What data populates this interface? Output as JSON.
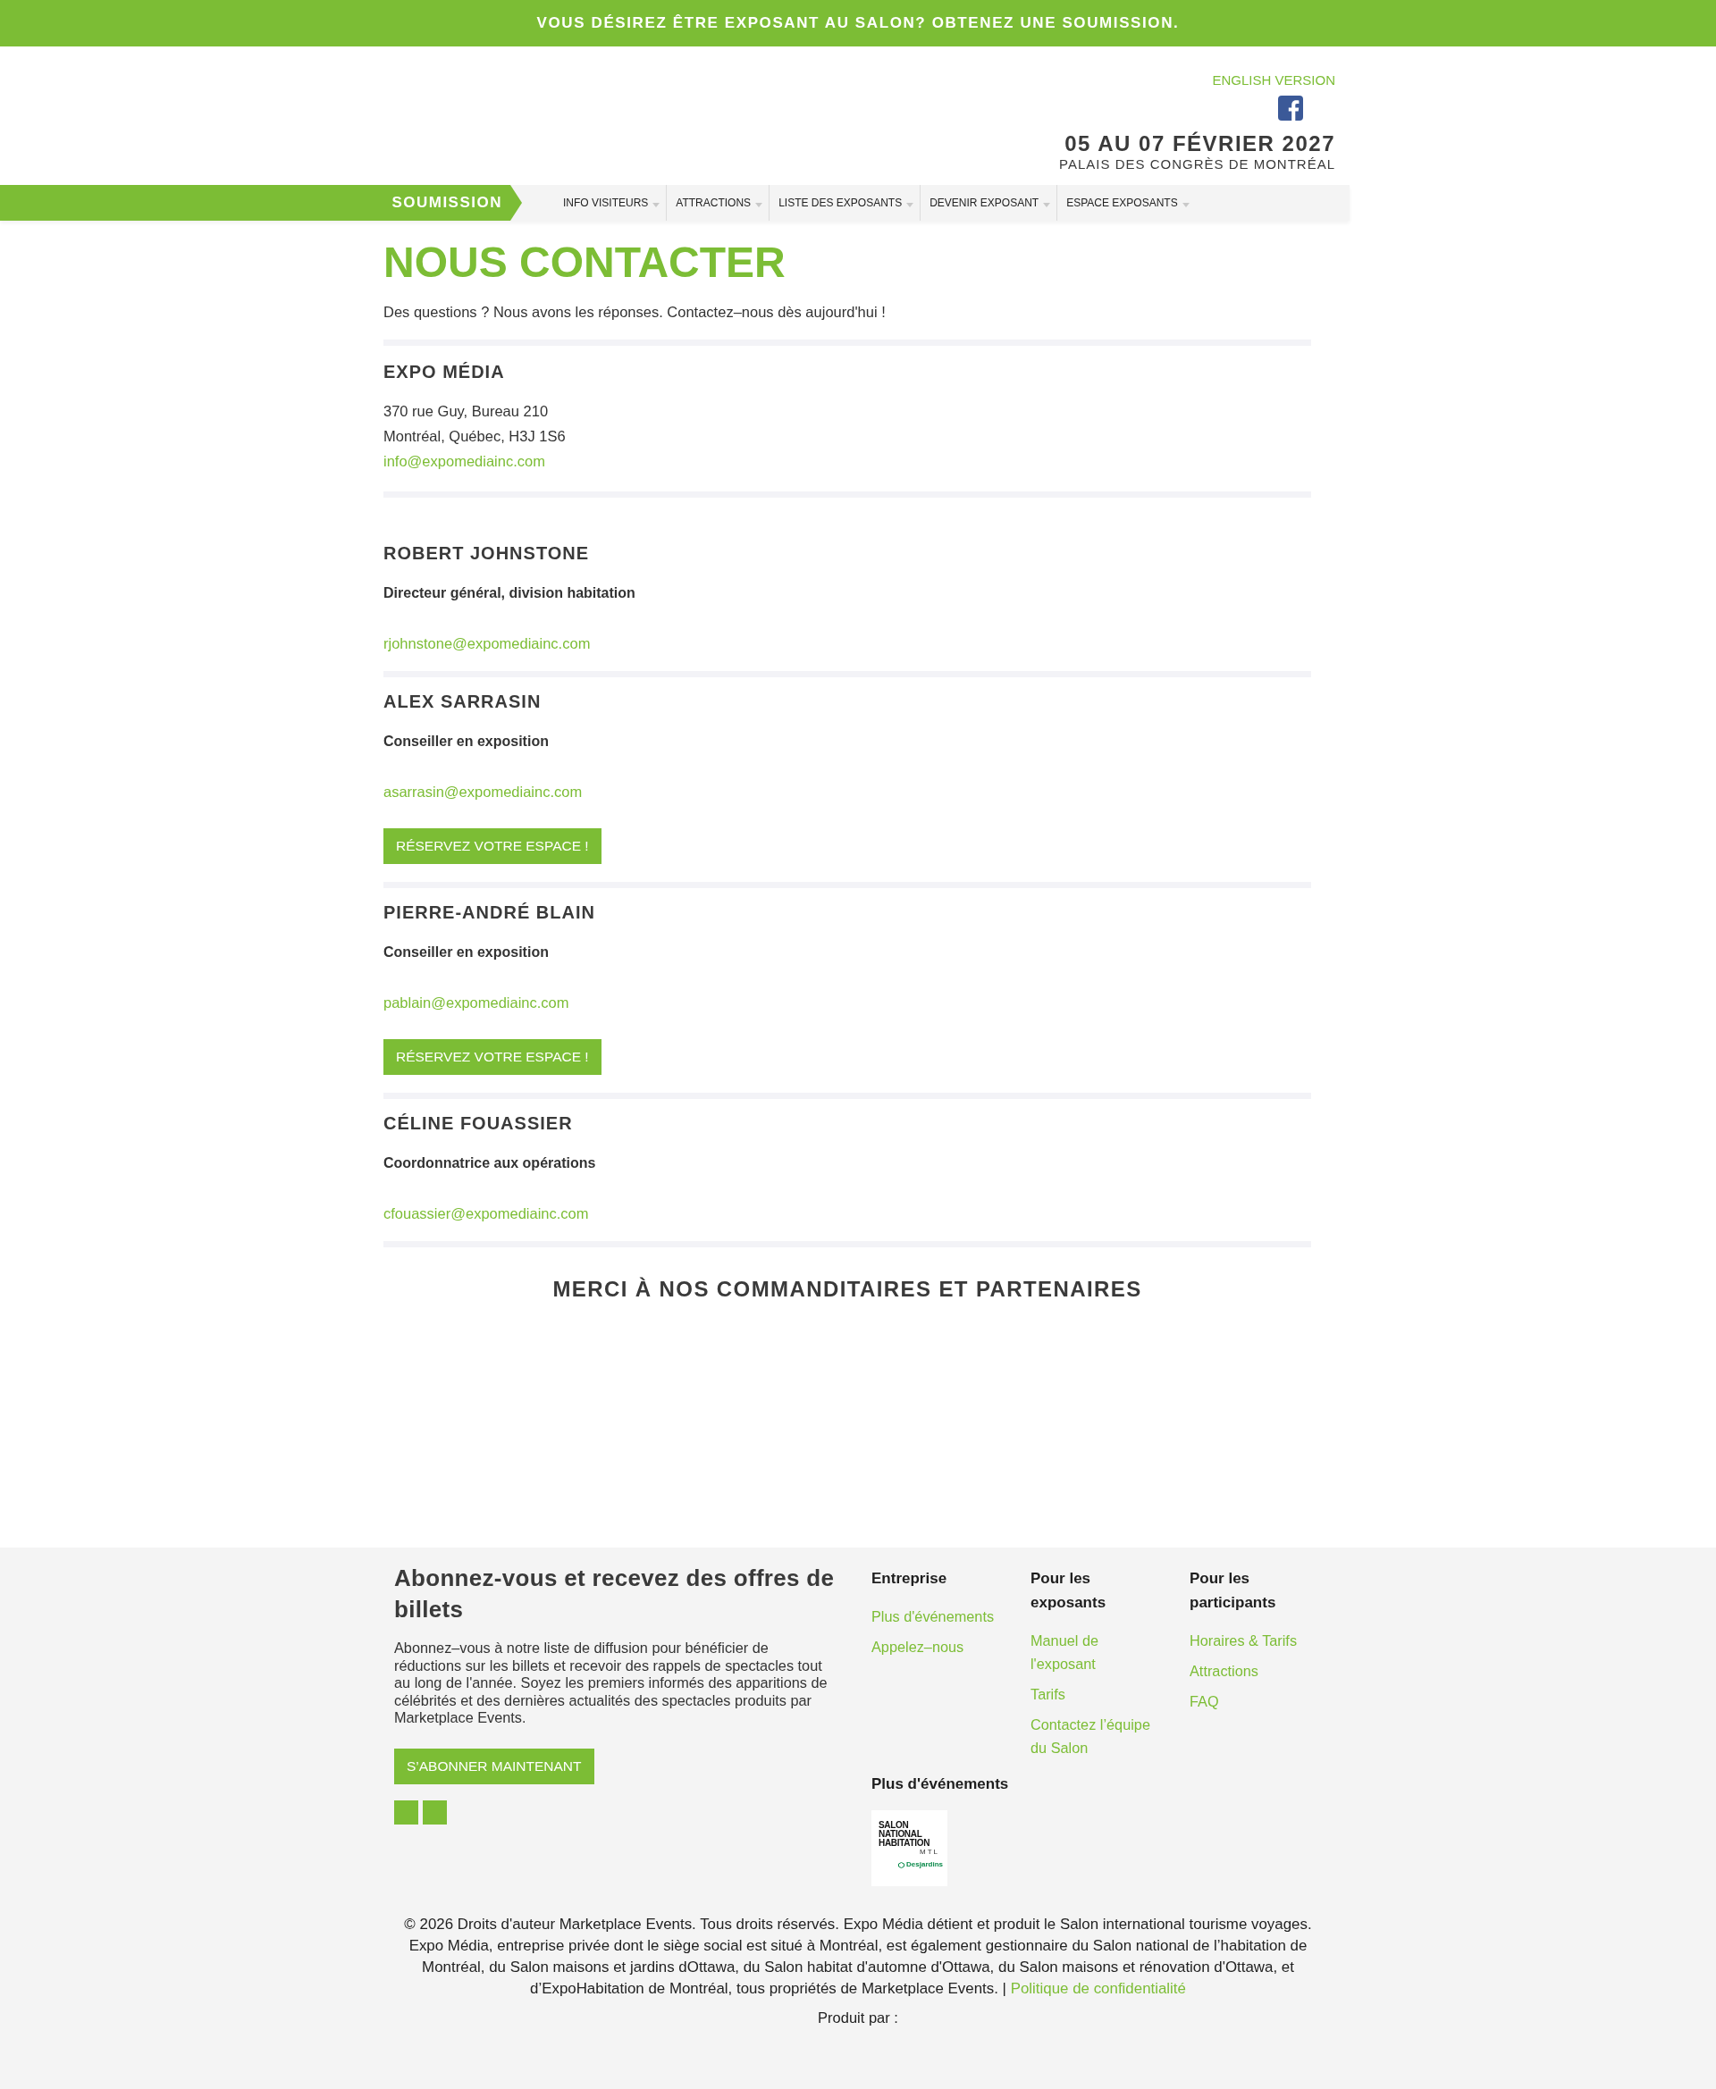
{
  "promo_banner": {
    "text": "VOUS DÉSIREZ ÊTRE EXPOSANT AU SALON? OBTENEZ UNE SOUMISSION."
  },
  "header": {
    "language_link": "ENGLISH VERSION",
    "dates": "05 AU 07 FÉVRIER 2027",
    "venue": "PALAIS DES CONGRÈS DE MONTRÉAL"
  },
  "nav": {
    "cta": "SOUMISSION",
    "items": [
      {
        "label": "INFO VISITEURS",
        "dropdown": true
      },
      {
        "label": "ATTRACTIONS",
        "dropdown": true
      },
      {
        "label": "LISTE DES EXPOSANTS",
        "dropdown": true
      },
      {
        "label": "DEVENIR EXPOSANT",
        "dropdown": true
      },
      {
        "label": "ESPACE EXPOSANTS",
        "dropdown": true
      }
    ]
  },
  "page": {
    "title": "NOUS CONTACTER",
    "intro": "Des questions ? Nous avons les réponses. Contactez–nous dès aujourd'hui !",
    "company": {
      "name": "EXPO MÉDIA",
      "address_lines": [
        "370 rue Guy, Bureau 210",
        "Montréal, Québec, H3J 1S6"
      ],
      "email": "info@expomediainc.com"
    },
    "contacts": [
      {
        "name": "ROBERT JOHNSTONE",
        "role": "Directeur général, division habitation",
        "email": "rjohnstone@expomediainc.com"
      },
      {
        "name": "ALEX SARRASIN",
        "role": "Conseiller en exposition",
        "email": "asarrasin@expomediainc.com",
        "button": "RÉSERVEZ VOTRE ESPACE !"
      },
      {
        "name": "PIERRE-ANDRÉ BLAIN",
        "role": "Conseiller en exposition",
        "email": "pablain@expomediainc.com",
        "button": "RÉSERVEZ VOTRE ESPACE !"
      },
      {
        "name": "CÉLINE FOUASSIER",
        "role": "Coordonnatrice aux opérations",
        "email": "cfouassier@expomediainc.com"
      }
    ]
  },
  "sponsors": {
    "title": "MERCI À NOS COMMANDITAIRES ET PARTENAIRES"
  },
  "footer": {
    "newsletter": {
      "title": "Abonnez-vous et recevez des offres de billets",
      "text": "Abonnez–vous à notre liste de diffusion pour bénéficier de réductions sur les billets et recevoir des rappels de spectacles tout au long de l'année. Soyez les premiers informés des apparitions de célébrités et des dernières actualités des spectacles produits par Marketplace Events.",
      "button": "S’ABONNER MAINTENANT"
    },
    "link_columns": [
      {
        "title": "Entreprise",
        "links": [
          "Plus d'événements",
          "Appelez–nous"
        ]
      },
      {
        "title": "Pour les exposants",
        "links": [
          "Manuel de l'exposant",
          "Tarifs",
          "Contactez l’équipe du Salon"
        ]
      },
      {
        "title": "Pour les participants",
        "links": [
          "Horaires & Tarifs",
          "Attractions",
          "FAQ"
        ]
      }
    ],
    "events": {
      "title": "Plus d'événements",
      "logos": [
        {
          "lines": [
            "SALON",
            "NATIONAL",
            "HABITATION"
          ],
          "city": "MTL",
          "sponsor": "Desjardins"
        }
      ]
    },
    "copyright": "© 2026 Droits d'auteur Marketplace Events. Tous droits réservés. Expo Média détient et produit le Salon international tourisme voyages. Expo Média, entreprise privée dont le siège social est situé à Montréal, est également gestionnaire du Salon national de l’habitation de Montréal, du Salon maisons et jardins dOttawa, du Salon habitat d'automne d'Ottawa, du Salon maisons et rénovation d'Ottawa, et d’ExpoHabitation de Montréal, tous propriétés de Marketplace Events. |",
    "privacy_link": "Politique de confidentialité",
    "produced_by": "Produit par :"
  }
}
